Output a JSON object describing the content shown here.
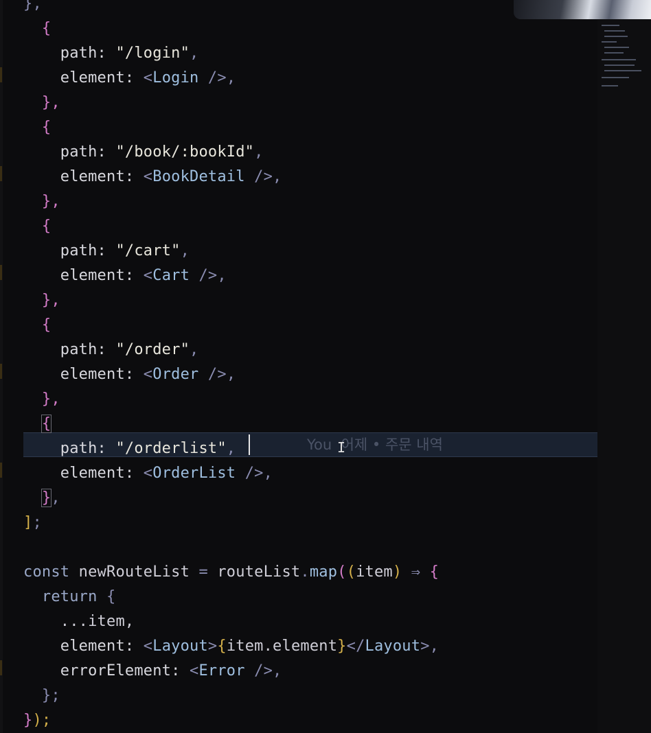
{
  "code_lines": [
    [
      {
        "t": "},",
        "c": "p"
      }
    ],
    [
      {
        "t": "  "
      },
      {
        "t": "{",
        "c": "pk"
      }
    ],
    [
      {
        "t": "    "
      },
      {
        "t": "path: ",
        "c": "k"
      },
      {
        "t": "\"/login\"",
        "c": "s"
      },
      {
        "t": ",",
        "c": "x"
      }
    ],
    [
      {
        "t": "    "
      },
      {
        "t": "element: ",
        "c": "k"
      },
      {
        "t": "<",
        "c": "p"
      },
      {
        "t": "Login",
        "c": "t"
      },
      {
        "t": " />",
        "c": "p"
      },
      {
        "t": ",",
        "c": "x"
      }
    ],
    [
      {
        "t": "  "
      },
      {
        "t": "},",
        "c": "pk"
      }
    ],
    [
      {
        "t": "  "
      },
      {
        "t": "{",
        "c": "pk"
      }
    ],
    [
      {
        "t": "    "
      },
      {
        "t": "path: ",
        "c": "k"
      },
      {
        "t": "\"/book/:bookId\"",
        "c": "s"
      },
      {
        "t": ",",
        "c": "x"
      }
    ],
    [
      {
        "t": "    "
      },
      {
        "t": "element: ",
        "c": "k"
      },
      {
        "t": "<",
        "c": "p"
      },
      {
        "t": "BookDetail",
        "c": "t"
      },
      {
        "t": " />",
        "c": "p"
      },
      {
        "t": ",",
        "c": "x"
      }
    ],
    [
      {
        "t": "  "
      },
      {
        "t": "},",
        "c": "pk"
      }
    ],
    [
      {
        "t": "  "
      },
      {
        "t": "{",
        "c": "pk"
      }
    ],
    [
      {
        "t": "    "
      },
      {
        "t": "path: ",
        "c": "k"
      },
      {
        "t": "\"/cart\"",
        "c": "s"
      },
      {
        "t": ",",
        "c": "x"
      }
    ],
    [
      {
        "t": "    "
      },
      {
        "t": "element: ",
        "c": "k"
      },
      {
        "t": "<",
        "c": "p"
      },
      {
        "t": "Cart",
        "c": "t"
      },
      {
        "t": " />",
        "c": "p"
      },
      {
        "t": ",",
        "c": "x"
      }
    ],
    [
      {
        "t": "  "
      },
      {
        "t": "},",
        "c": "pk"
      }
    ],
    [
      {
        "t": "  "
      },
      {
        "t": "{",
        "c": "pk"
      }
    ],
    [
      {
        "t": "    "
      },
      {
        "t": "path: ",
        "c": "k"
      },
      {
        "t": "\"/order\"",
        "c": "s"
      },
      {
        "t": ",",
        "c": "x"
      }
    ],
    [
      {
        "t": "    "
      },
      {
        "t": "element: ",
        "c": "k"
      },
      {
        "t": "<",
        "c": "p"
      },
      {
        "t": "Order",
        "c": "t"
      },
      {
        "t": " />",
        "c": "p"
      },
      {
        "t": ",",
        "c": "x"
      }
    ],
    [
      {
        "t": "  "
      },
      {
        "t": "},",
        "c": "pk"
      }
    ],
    [
      {
        "t": "  "
      },
      {
        "t": "{",
        "c": "pk bm"
      }
    ],
    [
      {
        "t": "    "
      },
      {
        "t": "path: ",
        "c": "k"
      },
      {
        "t": "\"/orderlist\"",
        "c": "s"
      },
      {
        "t": ",",
        "c": "x"
      }
    ],
    [
      {
        "t": "    "
      },
      {
        "t": "element: ",
        "c": "k"
      },
      {
        "t": "<",
        "c": "p"
      },
      {
        "t": "OrderList",
        "c": "t"
      },
      {
        "t": " />",
        "c": "p"
      },
      {
        "t": ",",
        "c": "x"
      }
    ],
    [
      {
        "t": "  "
      },
      {
        "t": "}",
        "c": "pk bm"
      },
      {
        "t": ",",
        "c": "x"
      }
    ],
    [
      {
        "t": "]",
        "c": "pb"
      },
      {
        "t": ";",
        "c": "x"
      }
    ],
    [],
    [
      {
        "t": "const ",
        "c": "kw"
      },
      {
        "t": "newRouteList ",
        "c": "v"
      },
      {
        "t": "= ",
        "c": "x"
      },
      {
        "t": "routeList",
        "c": "v"
      },
      {
        "t": ".",
        "c": "x"
      },
      {
        "t": "map",
        "c": "m"
      },
      {
        "t": "(",
        "c": "pk"
      },
      {
        "t": "(",
        "c": "pb"
      },
      {
        "t": "item",
        "c": "v"
      },
      {
        "t": ") ",
        "c": "pb"
      },
      {
        "t": "⇒ ",
        "c": "x"
      },
      {
        "t": "{",
        "c": "pk"
      }
    ],
    [
      {
        "t": "  "
      },
      {
        "t": "return ",
        "c": "kw"
      },
      {
        "t": "{",
        "c": "p"
      }
    ],
    [
      {
        "t": "    "
      },
      {
        "t": "...item,",
        "c": "v"
      }
    ],
    [
      {
        "t": "    "
      },
      {
        "t": "element: ",
        "c": "k"
      },
      {
        "t": "<",
        "c": "p"
      },
      {
        "t": "Layout",
        "c": "t"
      },
      {
        "t": ">",
        "c": "p"
      },
      {
        "t": "{",
        "c": "pb"
      },
      {
        "t": "item.element",
        "c": "v"
      },
      {
        "t": "}",
        "c": "pb"
      },
      {
        "t": "</",
        "c": "p"
      },
      {
        "t": "Layout",
        "c": "t"
      },
      {
        "t": ">",
        "c": "p"
      },
      {
        "t": ",",
        "c": "x"
      }
    ],
    [
      {
        "t": "    "
      },
      {
        "t": "errorElement: ",
        "c": "k"
      },
      {
        "t": "<",
        "c": "p"
      },
      {
        "t": "Error",
        "c": "t"
      },
      {
        "t": " />",
        "c": "p"
      },
      {
        "t": ",",
        "c": "x"
      }
    ],
    [
      {
        "t": "  "
      },
      {
        "t": "};",
        "c": "p"
      }
    ],
    [
      {
        "t": "}",
        "c": "pk"
      },
      {
        "t": ");",
        "c": "pb"
      }
    ]
  ],
  "blame": {
    "author": "You",
    "text": "어제 • 주문 내역"
  },
  "colors": {
    "background": "#0c0c0e",
    "current_line": "#1a2230",
    "string": "#e8e6dc",
    "component": "#9fbfe0",
    "keyword": "#9aa8c8",
    "bracket_pink": "#d47cc8",
    "bracket_gold": "#d4b04a"
  }
}
